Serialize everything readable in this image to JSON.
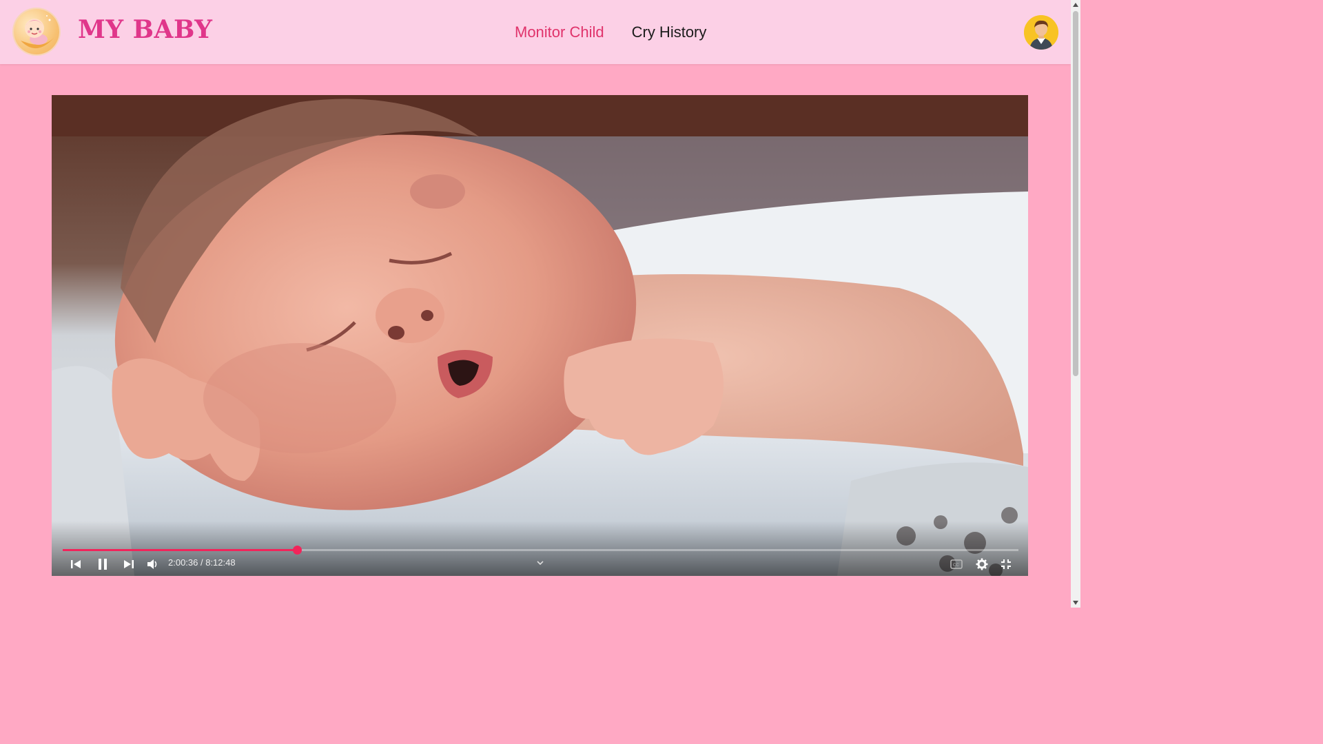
{
  "header": {
    "brand": "MY BABY",
    "nav": [
      {
        "label": "Monitor Child",
        "active": true
      },
      {
        "label": "Cry History",
        "active": false
      }
    ]
  },
  "player": {
    "time_display": "2:00:36 / 8:12:48",
    "progress": 0.245,
    "accent_color": "#f2245a",
    "icons": [
      "previous-icon",
      "pause-icon",
      "next-icon",
      "volume-icon",
      "chevron-down-icon",
      "captions-icon",
      "settings-icon",
      "exit-fullscreen-icon"
    ]
  },
  "colors": {
    "page_bg": "#ffa9c4",
    "header_bg": "#fcd0e6",
    "brand": "#e0368a",
    "nav_active": "#e0336b"
  }
}
